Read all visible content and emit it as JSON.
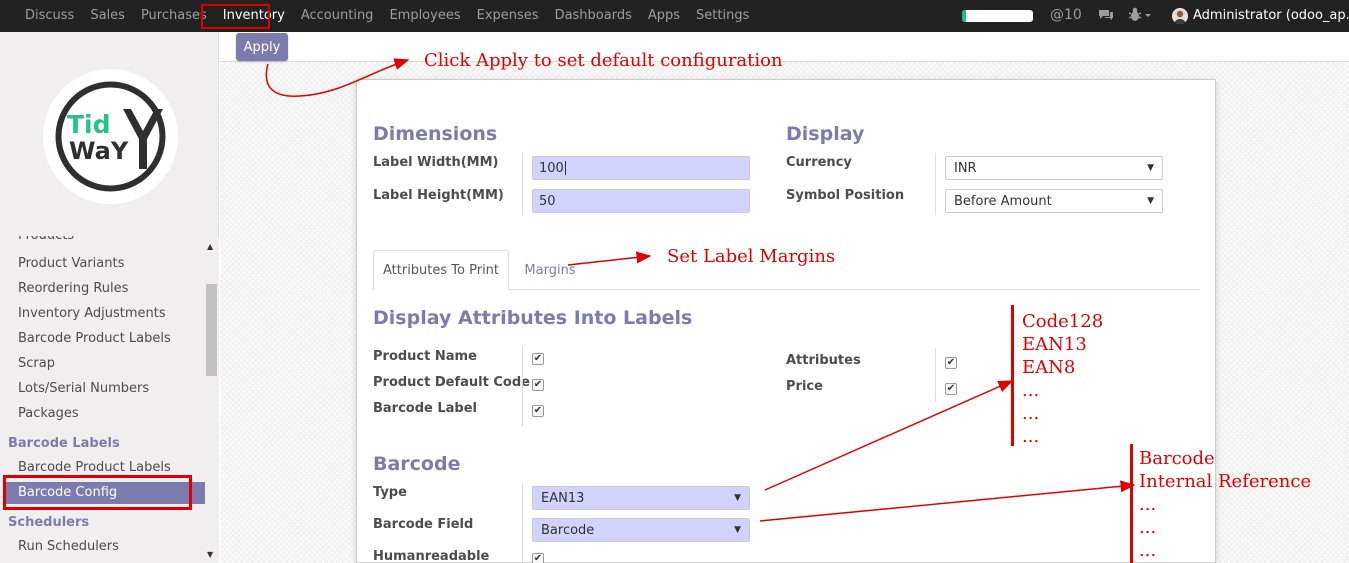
{
  "topbar": {
    "menu": [
      "Discuss",
      "Sales",
      "Purchases",
      "Inventory",
      "Accounting",
      "Employees",
      "Expenses",
      "Dashboards",
      "Apps",
      "Settings"
    ],
    "active_menu": "Inventory",
    "message_count": "@10",
    "progress_fraction": 0.06,
    "user": "Administrator (odoo_ap..."
  },
  "logo": {
    "text_top": "Tid",
    "text_bottom": "WaY"
  },
  "sidebar": {
    "items": [
      "Products",
      "Product Variants",
      "Reordering Rules",
      "Inventory Adjustments",
      "Barcode Product Labels",
      "Scrap",
      "Lots/Serial Numbers",
      "Packages"
    ],
    "section_barcode": "Barcode Labels",
    "barcode_items": [
      "Barcode Product Labels",
      "Barcode Config"
    ],
    "selected": "Barcode Config",
    "section_schedulers": "Schedulers",
    "scheduler_items": [
      "Run Schedulers"
    ]
  },
  "control": {
    "apply_label": "Apply"
  },
  "form": {
    "dimensions_title": "Dimensions",
    "label_width_label": "Label Width(MM)",
    "label_width_value": "100",
    "label_height_label": "Label Height(MM)",
    "label_height_value": "50",
    "display_title": "Display",
    "currency_label": "Currency",
    "currency_value": "INR",
    "symbol_position_label": "Symbol Position",
    "symbol_position_value": "Before Amount",
    "tabs": [
      "Attributes To Print",
      "Margins"
    ],
    "attrs_title": "Display Attributes Into Labels",
    "product_name_label": "Product Name",
    "product_default_code_label": "Product Default Code",
    "barcode_label_label": "Barcode Label",
    "attributes_label": "Attributes",
    "price_label": "Price",
    "checks": {
      "product_name": true,
      "product_default_code": true,
      "barcode_label": true,
      "attributes": true,
      "price": true,
      "humanreadable": true
    },
    "barcode_title": "Barcode",
    "type_label": "Type",
    "type_value": "EAN13",
    "barcode_field_label": "Barcode Field",
    "barcode_field_value": "Barcode",
    "humanreadable_label": "Humanreadable"
  },
  "annotations": {
    "apply_note": "Click Apply to set default configuration",
    "margins_note": "Set Label Margins",
    "type_options": [
      "Code128",
      "EAN13",
      "EAN8",
      "...",
      "...",
      "..."
    ],
    "field_options": [
      "Barcode",
      "Internal Reference",
      "...",
      "...",
      "..."
    ]
  },
  "colors": {
    "accent": "#7c7bad",
    "annotation": "#e10000",
    "required_field": "#d2d2ff",
    "topbar": "#222222"
  }
}
